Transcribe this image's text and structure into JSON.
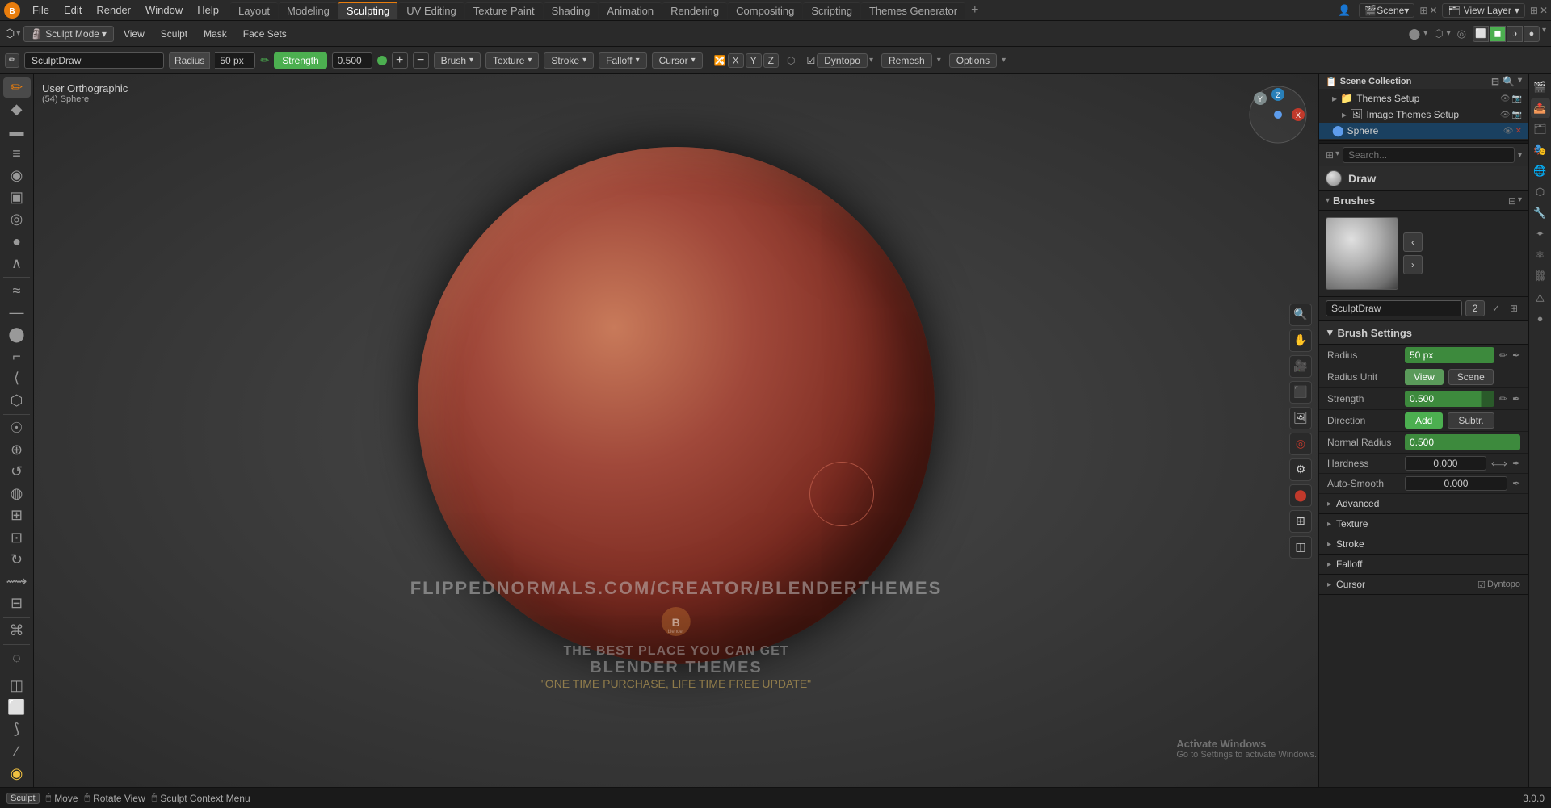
{
  "app": {
    "title": "Blender"
  },
  "topMenu": {
    "items": [
      "Blender",
      "File",
      "Edit",
      "Render",
      "Window",
      "Help"
    ]
  },
  "workspaceTabs": {
    "tabs": [
      "Layout",
      "Modeling",
      "Sculpting",
      "UV Editing",
      "Texture Paint",
      "Shading",
      "Animation",
      "Rendering",
      "Compositing",
      "Scripting",
      "Themes Generator"
    ],
    "active": "Sculpting",
    "addLabel": "+"
  },
  "topRight": {
    "userIcon": "👤",
    "sceneLabel": "Scene",
    "viewLayerLabel": "View Layer"
  },
  "modeToolbar": {
    "modeLabel": "Sculpt Mode",
    "dropdownArrow": "▾",
    "menuItems": [
      "View",
      "Sculpt",
      "Mask",
      "Face Sets"
    ]
  },
  "brushToolbar": {
    "brushName": "SculptDraw",
    "radiusLabel": "Radius",
    "radiusValue": "50 px",
    "strengthLabel": "Strength",
    "strengthValue": "0.500",
    "brushDropdown": "Brush",
    "textureDropdown": "Texture",
    "strokeDropdown": "Stroke",
    "falloffDropdown": "Falloff",
    "cursorDropdown": "Cursor",
    "xyzBtns": [
      "X",
      "Y",
      "Z"
    ],
    "dyntopoLabel": "Dyntopo",
    "remeshLabel": "Remesh",
    "optionsLabel": "Options"
  },
  "viewport": {
    "labelLine1": "User Orthographic",
    "labelLine2": "(54) Sphere",
    "overlayUrl": "FLIPPEDNORMALS.COM/CREATOR/BLENDERTHEMES",
    "overlayText1": "THE BEST PLACE YOU CAN GET",
    "overlayText2": "BLENDER THEMES",
    "overlayText3": "\"ONE TIME PURCHASE, LIFE TIME FREE UPDATE\"",
    "logoText": "blender"
  },
  "leftTools": [
    {
      "name": "draw-tool",
      "icon": "✏",
      "active": true
    },
    {
      "name": "draw-sharp-tool",
      "icon": "◆",
      "active": false
    },
    {
      "name": "clay-tool",
      "icon": "▬",
      "active": false
    },
    {
      "name": "clay-strips-tool",
      "icon": "≡",
      "active": false
    },
    {
      "name": "clay-thumb-tool",
      "icon": "◉",
      "active": false
    },
    {
      "name": "layer-tool",
      "icon": "▣",
      "active": false
    },
    {
      "name": "inflate-tool",
      "icon": "◎",
      "active": false
    },
    {
      "name": "blob-tool",
      "icon": "●",
      "active": false
    },
    {
      "name": "crease-tool",
      "icon": "∧",
      "active": false
    },
    {
      "name": "smooth-tool",
      "icon": "≈",
      "active": false
    },
    {
      "name": "flatten-tool",
      "icon": "—",
      "active": false
    },
    {
      "name": "fill-tool",
      "icon": "⬤",
      "active": false
    },
    {
      "name": "scrape-tool",
      "icon": "⌐",
      "active": false
    },
    {
      "name": "multiplane-scrape-tool",
      "icon": "⟨",
      "active": false
    },
    {
      "name": "pinch-tool",
      "icon": "⬡",
      "active": false
    },
    {
      "name": "grab-tool",
      "icon": "☉",
      "active": false
    },
    {
      "name": "elastic-deform-tool",
      "icon": "⊕",
      "active": false
    },
    {
      "name": "snake-hook-tool",
      "icon": "↺",
      "active": false
    },
    {
      "name": "thumb-tool",
      "icon": "◍",
      "active": false
    },
    {
      "name": "pose-tool",
      "icon": "⊞",
      "active": false
    },
    {
      "name": "nudge-tool",
      "icon": "⊡",
      "active": false
    },
    {
      "name": "rotate-tool",
      "icon": "↻",
      "active": false
    },
    {
      "name": "slide-relax-tool",
      "icon": "⟿",
      "active": false
    },
    {
      "name": "boundary-tool",
      "icon": "⊟",
      "active": false
    },
    {
      "name": "cloth-tool",
      "icon": "⌘",
      "active": false
    },
    {
      "name": "simplify-tool",
      "icon": "◌",
      "active": false
    },
    {
      "name": "mask-tool",
      "icon": "◫",
      "active": false
    },
    {
      "name": "box-mask-tool",
      "icon": "⬜",
      "active": false
    },
    {
      "name": "lasso-mask-tool",
      "icon": "⟆",
      "active": false
    },
    {
      "name": "line-mask-tool",
      "icon": "⁄",
      "active": false
    },
    {
      "name": "polyline-mask-tool",
      "icon": "⟁",
      "active": false
    },
    {
      "name": "face-set-tool",
      "icon": "◨",
      "active": false
    }
  ],
  "rightPanel": {
    "outliner": {
      "header": "Scene Collection",
      "items": [
        {
          "name": "Themes Setup",
          "icon": "📁",
          "indent": 1
        },
        {
          "name": "Image Themes Setup",
          "icon": "🖼",
          "indent": 2
        },
        {
          "name": "Sphere",
          "icon": "⬤",
          "indent": 2,
          "selected": true
        }
      ]
    },
    "brushSection": {
      "header": "Draw",
      "brushLabel": "Brushes",
      "brushName": "SculptDraw",
      "brushNum": "2"
    },
    "brushSettings": {
      "header": "Brush Settings",
      "radiusLabel": "Radius",
      "radiusValue": "50 px",
      "radiusUnitLabel": "Radius Unit",
      "viewBtn": "View",
      "sceneBtn": "Scene",
      "strengthLabel": "Strength",
      "strengthValue": "0.500",
      "directionLabel": "Direction",
      "addBtn": "Add",
      "subtrBtn": "Subtr.",
      "normalRadiusLabel": "Normal Radius",
      "normalRadiusValue": "0.500",
      "hardnessLabel": "Hardness",
      "hardnessValue": "0.000",
      "autoSmoothLabel": "Auto-Smooth",
      "autoSmoothValue": "0.000"
    },
    "collapsibles": [
      {
        "label": "Advanced",
        "expanded": false
      },
      {
        "label": "Texture",
        "expanded": false
      },
      {
        "label": "Stroke",
        "expanded": false
      },
      {
        "label": "Falloff",
        "expanded": false
      },
      {
        "label": "Cursor",
        "expanded": false
      },
      {
        "label": "Dyntopo",
        "expanded": false
      }
    ]
  },
  "statusBar": {
    "items": [
      {
        "key": "Sculpt",
        "action": ""
      },
      {
        "key": "Move",
        "icon": "🖱"
      },
      {
        "key": "Rotate View",
        "icon": ""
      },
      {
        "key": "Sculpt Context Menu",
        "icon": ""
      }
    ],
    "versionLabel": "3.0.0"
  },
  "activateWindows": {
    "line1": "Activate Windows",
    "line2": "Go to Settings to activate Windows."
  }
}
